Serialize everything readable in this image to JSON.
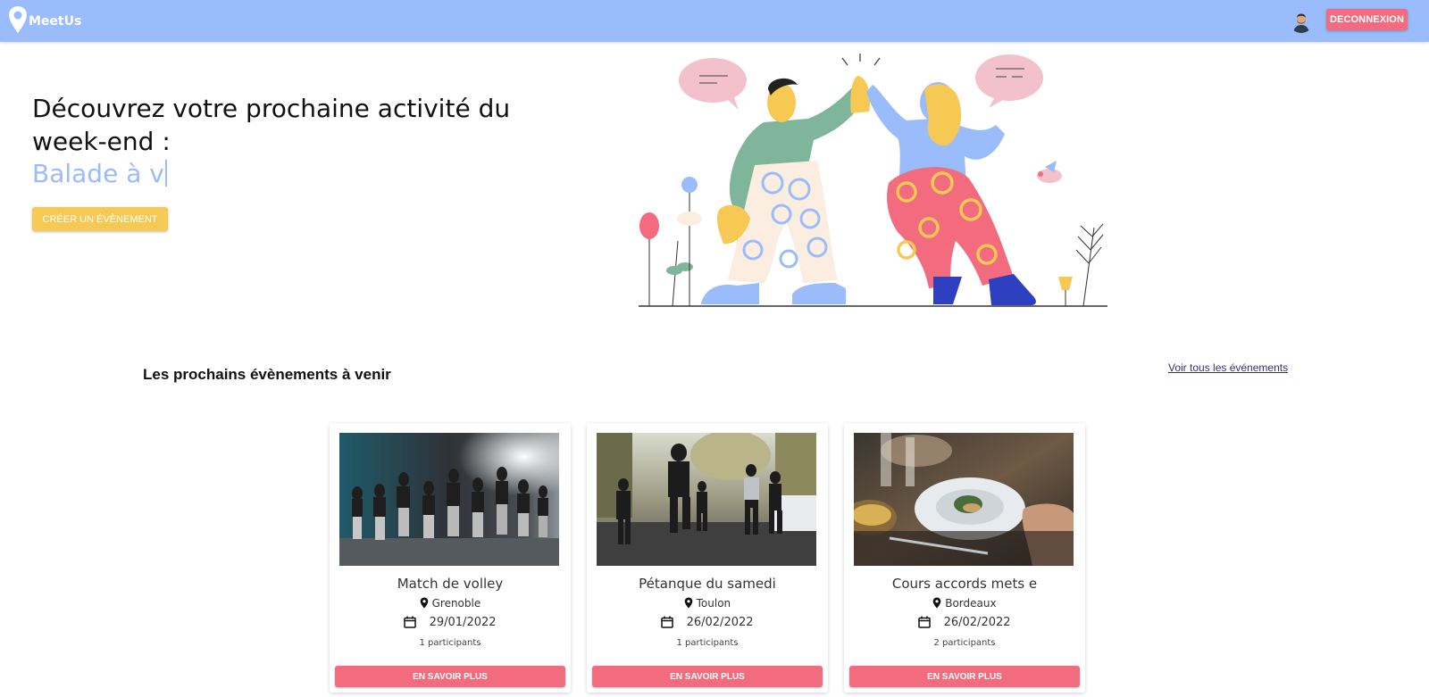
{
  "navbar": {
    "brand": "MeetUs",
    "logout_label": "DECONNEXION",
    "colors": {
      "bar": "#9bbcfb",
      "logout": "#f26b7f"
    }
  },
  "hero": {
    "title": "Découvrez votre prochaine activité du week-end :",
    "typed_text": "Balade à v",
    "create_label": "CRÉER UN ÉVÈNEMENT",
    "colors": {
      "typed": "#9bbcfb",
      "create_button": "#f6c955"
    }
  },
  "events_section": {
    "title": "Les prochains évènements à venir",
    "see_all_label": "Voir tous les événements",
    "cards": [
      {
        "title": "Match de volley",
        "city": "Grenoble",
        "date": "29/01/2022",
        "participants": "1 participants",
        "button_label": "EN SAVOIR PLUS",
        "image": "dance-stage-photo"
      },
      {
        "title": "Pétanque du samedi",
        "city": "Toulon",
        "date": "26/02/2022",
        "participants": "1 participants",
        "button_label": "EN SAVOIR PLUS",
        "image": "street-runners-photo"
      },
      {
        "title": "Cours accords mets e",
        "city": "Bordeaux",
        "date": "26/02/2022",
        "participants": "2 participants",
        "button_label": "EN SAVOIR PLUS",
        "image": "restaurant-dinner-photo"
      }
    ]
  },
  "icons": [
    "map-pin-icon",
    "location-pin-icon",
    "calendar-icon",
    "avatar"
  ]
}
